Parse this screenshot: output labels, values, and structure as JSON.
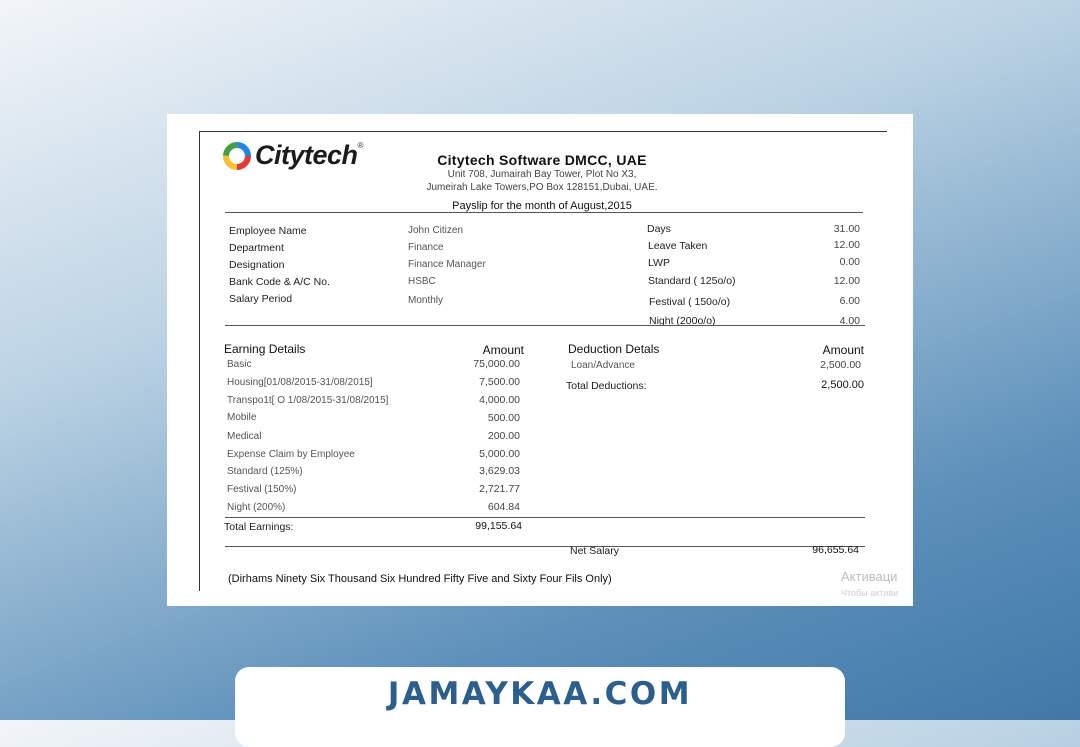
{
  "header": {
    "logo_text": "Citytech",
    "company": "Citytech  Software  DMCC,  UAE",
    "address_line1": "Unit 708, Jumairah Bay Tower, Plot No X3,",
    "address_line2": "Jumeirah Lake Towers,PO Box 128151,Dubai, UAE.",
    "payslip_title": "Payslip  for   the  month  of  August,2015"
  },
  "employee": [
    {
      "label": "Employee Name",
      "value": "John Citizen"
    },
    {
      "label": "Department",
      "value": "Finance"
    },
    {
      "label": "Designation",
      "value": "Finance  Manager"
    },
    {
      "label": "Bank Code & A/C No.",
      "value": "HSBC"
    },
    {
      "label": "Salary Period",
      "value": "Monthly"
    }
  ],
  "attendance": [
    {
      "label": "Days",
      "value": "31.00"
    },
    {
      "label": "Leave Taken",
      "value": "12.00"
    },
    {
      "label": "LWP",
      "value": "0.00"
    },
    {
      "label": "Standard  ( 125o/o)",
      "value": "12.00"
    },
    {
      "label": "Festival   ( 150o/o)",
      "value": "6.00"
    },
    {
      "label": "Night (200o/o)",
      "value": "4.00"
    }
  ],
  "earnings": {
    "heading": "Earning Details",
    "amount_heading": "Amount",
    "items": [
      {
        "label": "Basic",
        "amount": "75,000.00"
      },
      {
        "label": "Housing[01/08/2015-31/08/2015]",
        "amount": "7,500.00"
      },
      {
        "label": "Transpo1t[ O 1/08/2015-31/08/2015]",
        "amount": "4,000.00"
      },
      {
        "label": "Mobile",
        "amount": "500.00"
      },
      {
        "label": "Medical",
        "amount": "200.00"
      },
      {
        "label": "Expense Claim by Employee",
        "amount": "5,000.00"
      },
      {
        "label": "Standard  (125%)",
        "amount": "3,629.03"
      },
      {
        "label": "Festival (150%)",
        "amount": "2,721.77"
      },
      {
        "label": "Night (200%)",
        "amount": "604.84"
      }
    ],
    "total_label": "Total  Earnings:",
    "total_amount": "99,155.64"
  },
  "deductions": {
    "heading": "Deduction Detals",
    "amount_heading": "Amount",
    "items": [
      {
        "label": "Loan/Advance",
        "amount": "2,500.00"
      }
    ],
    "total_label": "Total   Deductions:",
    "total_amount": "2,500.00"
  },
  "net": {
    "label": "Net Salary",
    "amount": "96,655.64",
    "in_words": "(Dirhams Ninety Six Thousand Six Hundred Fifty Five and Sixty Four Fils Only)"
  },
  "watermark": {
    "line1": "Активаци",
    "line2": "Чтобы активи"
  },
  "banner": {
    "text": "JAMAYKAA.COM"
  }
}
